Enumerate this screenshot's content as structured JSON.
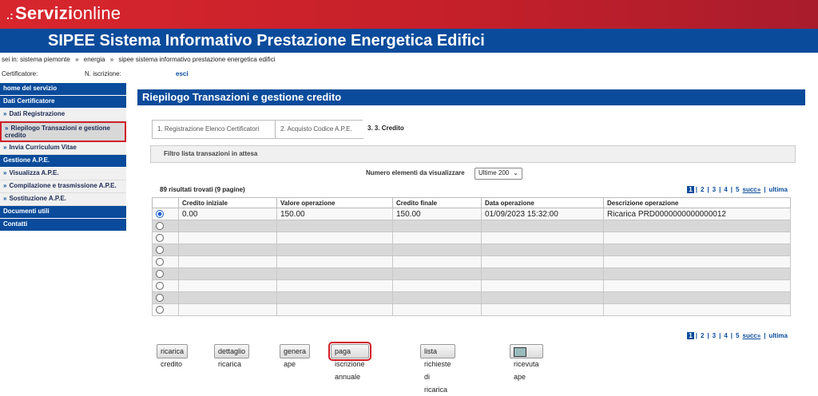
{
  "header": {
    "brand_dots": ".:",
    "brand_bold": "Servizi",
    "brand_light": "online",
    "app_title": "SIPEE Sistema Informativo Prestazione Energetica Edifici",
    "colors": {
      "red": "#d8262d",
      "blue": "#0a4b9b"
    }
  },
  "breadcrumb": {
    "prefix": "sei in:",
    "items": [
      "sistema piemonte",
      "energia",
      "sipee sistema informativo prestazione energetica edifici"
    ],
    "separator": "»"
  },
  "userline": {
    "certificatore_label": "Certificatore:",
    "iscrizione_label": "N. iscrizione:",
    "esci": "esci"
  },
  "sidebar": {
    "arrow": "»",
    "items": [
      {
        "label": "home del servizio",
        "kind": "head"
      },
      {
        "label": "Dati Certificatore",
        "kind": "head"
      },
      {
        "label": "Dati Registrazione",
        "kind": "item"
      },
      {
        "label": "Riepilogo Transazioni e gestione credito",
        "kind": "selected"
      },
      {
        "label": "Invia Curriculum Vitae",
        "kind": "item"
      },
      {
        "label": "Gestione A.P.E.",
        "kind": "head"
      },
      {
        "label": "Visualizza A.P.E.",
        "kind": "item"
      },
      {
        "label": "Compilazione e trasmissione A.P.E.",
        "kind": "item"
      },
      {
        "label": "Sostituzione A.P.E.",
        "kind": "item"
      },
      {
        "label": "Documenti utili",
        "kind": "head"
      },
      {
        "label": "Contatti",
        "kind": "head"
      }
    ]
  },
  "main": {
    "section_title": "Riepilogo Transazioni e gestione credito",
    "steps": [
      "1. Registrazione Elenco Certificatori",
      "2. Acquisto Codice A.P.E.",
      "3. 3. Credito"
    ],
    "filter_label": "Filtro lista transazioni in attesa",
    "num_elementi_label": "Numero elementi da visualizzare",
    "num_elementi_value": "Ultime 200",
    "chevron": "⌄",
    "results_text": "89 risultati trovati (9 pagine)",
    "pager": {
      "current": "1",
      "pages": [
        "2",
        "3",
        "4",
        "5"
      ],
      "sep": "|",
      "succ": "succ»",
      "ultima": "ultima"
    },
    "columns": [
      "",
      "Credito iniziale",
      "Valore operazione",
      "Credito finale",
      "Data operazione",
      "Descrizione operazione"
    ],
    "rows": [
      {
        "selected": true,
        "credito_iniziale": "0.00",
        "valore": "150.00",
        "credito_finale": "150.00",
        "data": "01/09/2023 15:32:00",
        "descrizione": "Ricarica PRD0000000000000012"
      },
      {
        "selected": false,
        "credito_iniziale": "",
        "valore": "",
        "credito_finale": "",
        "data": "",
        "descrizione": ""
      },
      {
        "selected": false,
        "credito_iniziale": "",
        "valore": "",
        "credito_finale": "",
        "data": "",
        "descrizione": ""
      },
      {
        "selected": false,
        "credito_iniziale": "",
        "valore": "",
        "credito_finale": "",
        "data": "",
        "descrizione": ""
      },
      {
        "selected": false,
        "credito_iniziale": "",
        "valore": "",
        "credito_finale": "",
        "data": "",
        "descrizione": ""
      },
      {
        "selected": false,
        "credito_iniziale": "",
        "valore": "",
        "credito_finale": "",
        "data": "",
        "descrizione": ""
      },
      {
        "selected": false,
        "credito_iniziale": "",
        "valore": "",
        "credito_finale": "",
        "data": "",
        "descrizione": ""
      },
      {
        "selected": false,
        "credito_iniziale": "",
        "valore": "",
        "credito_finale": "",
        "data": "",
        "descrizione": ""
      },
      {
        "selected": false,
        "credito_iniziale": "",
        "valore": "",
        "credito_finale": "",
        "data": "",
        "descrizione": ""
      }
    ],
    "buttons": {
      "ricarica": "ricarica credito",
      "dettaglio": "dettaglio ricarica",
      "genera": "genera ape",
      "paga": "paga iscrizione annuale",
      "lista": "lista richieste di ricarica",
      "ricevuta": "ricevuta ape",
      "ricevuta_icon": "computer-icon"
    }
  }
}
